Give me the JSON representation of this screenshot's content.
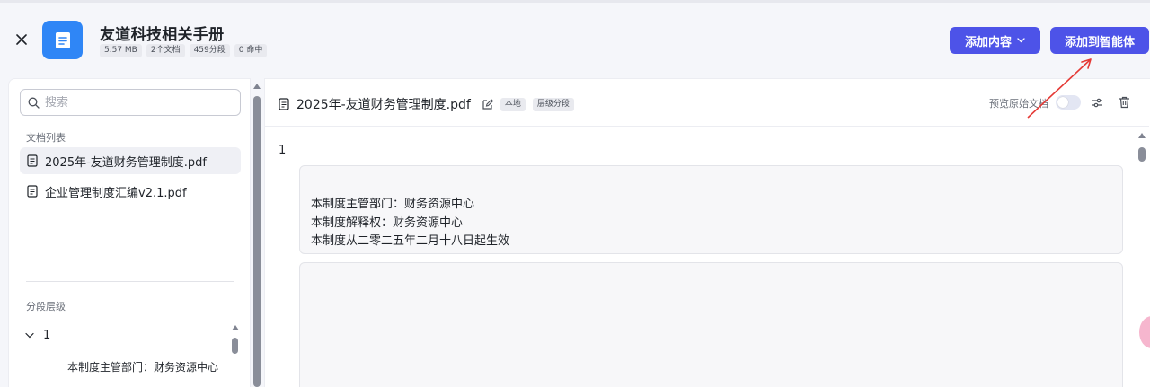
{
  "header": {
    "title": "友道科技相关手册",
    "stats": [
      "5.57 MB",
      "2个文档",
      "459分段",
      "0 命中"
    ],
    "add_content_label": "添加内容",
    "add_to_agent_label": "添加到智能体"
  },
  "sidebar": {
    "search_placeholder": "搜索",
    "doc_list_label": "文档列表",
    "docs": [
      {
        "name": "2025年-友道财务管理制度.pdf"
      },
      {
        "name": "企业管理制度汇编v2.1.pdf"
      }
    ],
    "segment_level_label": "分段层级",
    "tree": {
      "node_label": "1",
      "child_label": "本制度主管部门：财务资源中心"
    }
  },
  "document": {
    "name": "2025年-友道财务管理制度.pdf",
    "tags": [
      "本地",
      "层级分段"
    ],
    "preview_label": "预览原始文档",
    "segment_number": "1",
    "segment_lines": [
      "本制度主管部门：财务资源中心",
      "本制度解释权：财务资源中心",
      "本制度从二零二五年二月十八日起生效"
    ]
  },
  "colors": {
    "primary": "#4d53e8",
    "file_icon_bg": "#2f86f6",
    "annotation_arrow": "#e53935"
  },
  "icons": [
    "close-icon",
    "file-icon",
    "chevron-down-icon",
    "search-icon",
    "document-icon",
    "edit-icon",
    "settings-sliders-icon",
    "trash-icon"
  ]
}
